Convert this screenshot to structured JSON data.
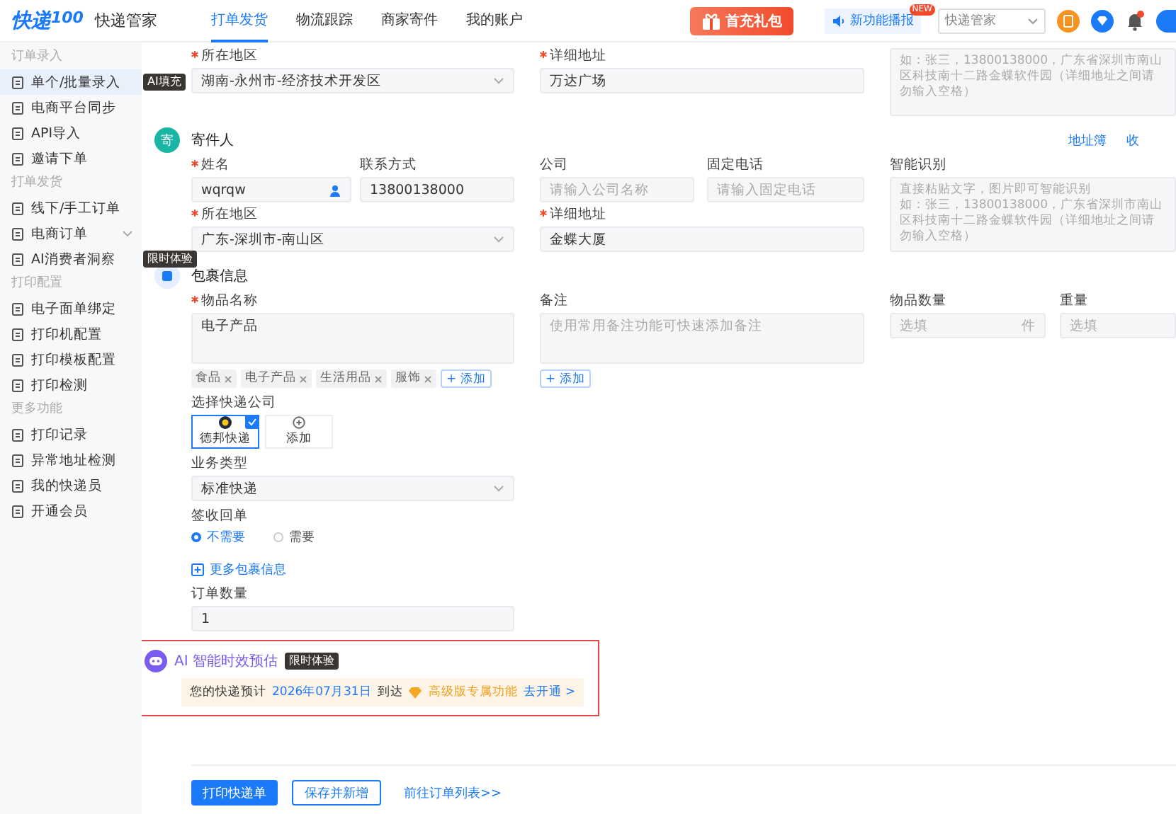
{
  "header": {
    "logo_main": "快递",
    "logo_num": "100",
    "app_name": "快递管家",
    "nav": [
      {
        "label": "打单发货",
        "selected": true
      },
      {
        "label": "物流跟踪",
        "selected": false
      },
      {
        "label": "商家寄件",
        "selected": false
      },
      {
        "label": "我的账户",
        "selected": false
      }
    ],
    "promo": "首充礼包",
    "news": "新功能播报",
    "news_badge": "NEW",
    "account_select": "快递管家"
  },
  "sidebar": [
    {
      "heading": "订单录入",
      "items": [
        {
          "label": "单个/批量录入",
          "selected": true,
          "kind": "link",
          "badge": "AI填充"
        },
        {
          "label": "电商平台同步",
          "selected": false,
          "kind": "link"
        },
        {
          "label": "API导入",
          "selected": false,
          "kind": "link"
        },
        {
          "label": "邀请下单",
          "selected": false,
          "kind": "link"
        }
      ]
    },
    {
      "heading": "打单发货",
      "items": [
        {
          "label": "线下/手工订单",
          "selected": false,
          "kind": "link"
        },
        {
          "label": "电商订单",
          "selected": false,
          "kind": "group"
        },
        {
          "label": "AI消费者洞察",
          "selected": false,
          "kind": "link",
          "badge": "限时体验"
        }
      ]
    },
    {
      "heading": "打印配置",
      "items": [
        {
          "label": "电子面单绑定",
          "selected": false,
          "kind": "link"
        },
        {
          "label": "打印机配置",
          "selected": false,
          "kind": "link"
        },
        {
          "label": "打印模板配置",
          "selected": false,
          "kind": "link"
        },
        {
          "label": "打印检测",
          "selected": false,
          "kind": "link"
        }
      ]
    },
    {
      "heading": "更多功能",
      "items": [
        {
          "label": "打印记录",
          "selected": false,
          "kind": "link"
        },
        {
          "label": "异常地址检测",
          "selected": false,
          "kind": "link"
        },
        {
          "label": "我的快递员",
          "selected": false,
          "kind": "link"
        },
        {
          "label": "开通会员",
          "selected": false,
          "kind": "link"
        }
      ]
    }
  ],
  "recipient": {
    "region": {
      "label": "所在地区",
      "required": true,
      "value": "湖南-永州市-经济技术开发区"
    },
    "address": {
      "label": "详细地址",
      "required": true,
      "value": "万达广场"
    },
    "smart": {
      "placeholder": "如：张三，13800138000，广东省深圳市南山区科技南十二路金蝶软件园（详细地址之间请勿输入空格）"
    }
  },
  "sender": {
    "title": "寄件人",
    "badge": "寄",
    "links": [
      "地址簿",
      "收"
    ],
    "name": {
      "label": "姓名",
      "required": true,
      "value": "wqrqw"
    },
    "phone": {
      "label": "联系方式",
      "required": false,
      "value": "13800138000"
    },
    "company": {
      "label": "公司",
      "required": false,
      "placeholder": "请输入公司名称"
    },
    "landline": {
      "label": "固定电话",
      "required": false,
      "placeholder": "请输入固定电话"
    },
    "smart": {
      "label": "智能识别",
      "placeholder": "直接粘贴文字，图片即可智能识别",
      "example": "如：张三，13800138000，广东省深圳市南山区科技南十二路金蝶软件园（详细地址之间请勿输入空格）"
    },
    "region": {
      "label": "所在地区",
      "required": true,
      "value": "广东-深圳市-南山区"
    },
    "address": {
      "label": "详细地址",
      "required": true,
      "value": "金蝶大厦"
    }
  },
  "package": {
    "title": "包裹信息",
    "item_name": {
      "label": "物品名称",
      "required": true,
      "value": "电子产品"
    },
    "tags": [
      "食品",
      "电子产品",
      "生活用品",
      "服饰"
    ],
    "tag_add": "+ 添加",
    "remarks": {
      "label": "备注",
      "required": false,
      "placeholder": "使用常用备注功能可快速添加备注",
      "add": "+ 添加"
    },
    "quantity": {
      "label": "物品数量",
      "placeholder": "选填",
      "unit": "件"
    },
    "weight": {
      "label": "重量",
      "placeholder": "选填"
    },
    "carriers": {
      "label": "选择快递公司",
      "items": [
        {
          "name": "德邦快递",
          "kind": "carrier",
          "selected": true
        },
        {
          "name": "添加",
          "kind": "add",
          "selected": false
        }
      ]
    },
    "service": {
      "label": "业务类型",
      "value": "标准快递"
    },
    "receipt": {
      "label": "签收回单",
      "options": [
        {
          "label": "不需要",
          "selected": true
        },
        {
          "label": "需要",
          "selected": false
        }
      ]
    },
    "more": "更多包裹信息",
    "order_count": {
      "label": "订单数量",
      "value": "1"
    }
  },
  "ai": {
    "title": "AI 智能时效预估",
    "badge": "限时体验",
    "prefix": "您的快递预计",
    "date": "2026年07月31日",
    "suffix": "到达",
    "premium": "高级版专属功能",
    "upgrade": "去开通 >"
  },
  "footer": {
    "primary": "打印快递单",
    "secondary": "保存并新增",
    "link": "前往订单列表>>"
  }
}
